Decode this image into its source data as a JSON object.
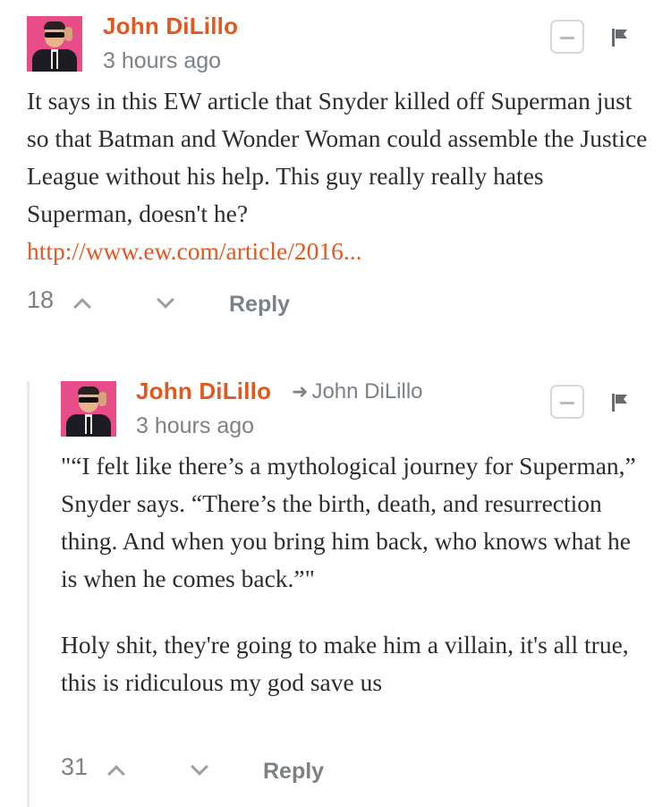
{
  "comments": [
    {
      "author": "John DiLillo",
      "time": "3 hours ago",
      "text": "It says in this EW article that Snyder killed off Superman just so that Batman and Wonder Woman could assemble the Justice League without his help. This guy really really hates Superman, doesn't he?",
      "link": "http://www.ew.com/article/2016...",
      "votes": "18",
      "reply_label": "Reply"
    },
    {
      "author": "John DiLillo",
      "reply_to": "John DiLillo",
      "time": "3 hours ago",
      "paragraphs": [
        "\"“I felt like there’s a mythological journey for Superman,” Snyder says. “There’s the birth, death, and resurrection thing. And when you bring him back, who knows what he is when he comes back.”\"",
        "Holy shit, they're going to make him a villain, it's all true, this is ridiculous my god save us"
      ],
      "votes": "31",
      "reply_label": "Reply"
    }
  ],
  "icons": {
    "collapse": "minus-box-icon",
    "flag": "flag-icon",
    "upvote": "chevron-up-icon",
    "downvote": "chevron-down-icon",
    "reply_arrow": "reply-arrow-icon"
  },
  "colors": {
    "author": "#e4571f",
    "link": "#e4571f",
    "meta": "#7b8185",
    "text": "#2a2e2e",
    "avatar_bg": "#e84d8a"
  }
}
